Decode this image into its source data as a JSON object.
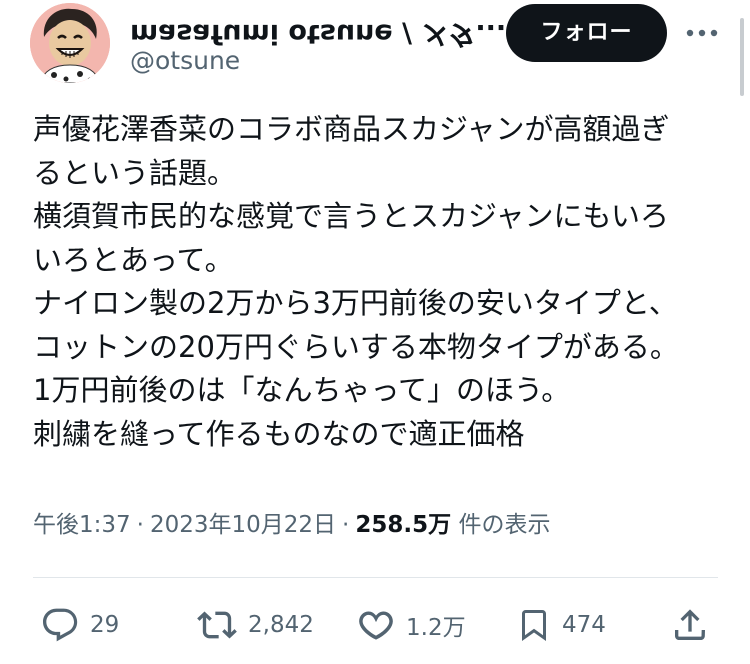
{
  "author": {
    "display_name": "masafumi otsune / メタ...",
    "handle": "@otsune",
    "follow_label": "フォロー"
  },
  "post": {
    "lines": [
      "声優花澤香菜のコラボ商品スカジャンが高額過ぎ",
      "るという話題。",
      "横須賀市民的な感覚で言うとスカジャンにもいろ",
      "いろとあって。",
      "ナイロン製の2万から3万円前後の安いタイプと、",
      "コットンの20万円ぐらいする本物タイプがある。",
      "1万円前後のは「なんちゃって」のほう。",
      "刺繍を縫って作るものなので適正価格"
    ]
  },
  "meta": {
    "time": "午後1:37",
    "separator": "·",
    "date": "2023年10月22日",
    "views_count": "258.5万",
    "views_label": "件の表示"
  },
  "actions": {
    "replies": "29",
    "reposts": "2,842",
    "likes": "1.2万",
    "bookmarks": "474"
  },
  "colors": {
    "text": "#0f1419",
    "secondary": "#536471",
    "button_bg": "#0f1419",
    "button_text": "#ffffff",
    "divider": "#e1e6ea"
  },
  "icons": {
    "more": "more-icon",
    "reply": "reply-icon",
    "repost": "repost-icon",
    "like": "heart-icon",
    "bookmark": "bookmark-icon",
    "share": "share-icon"
  }
}
